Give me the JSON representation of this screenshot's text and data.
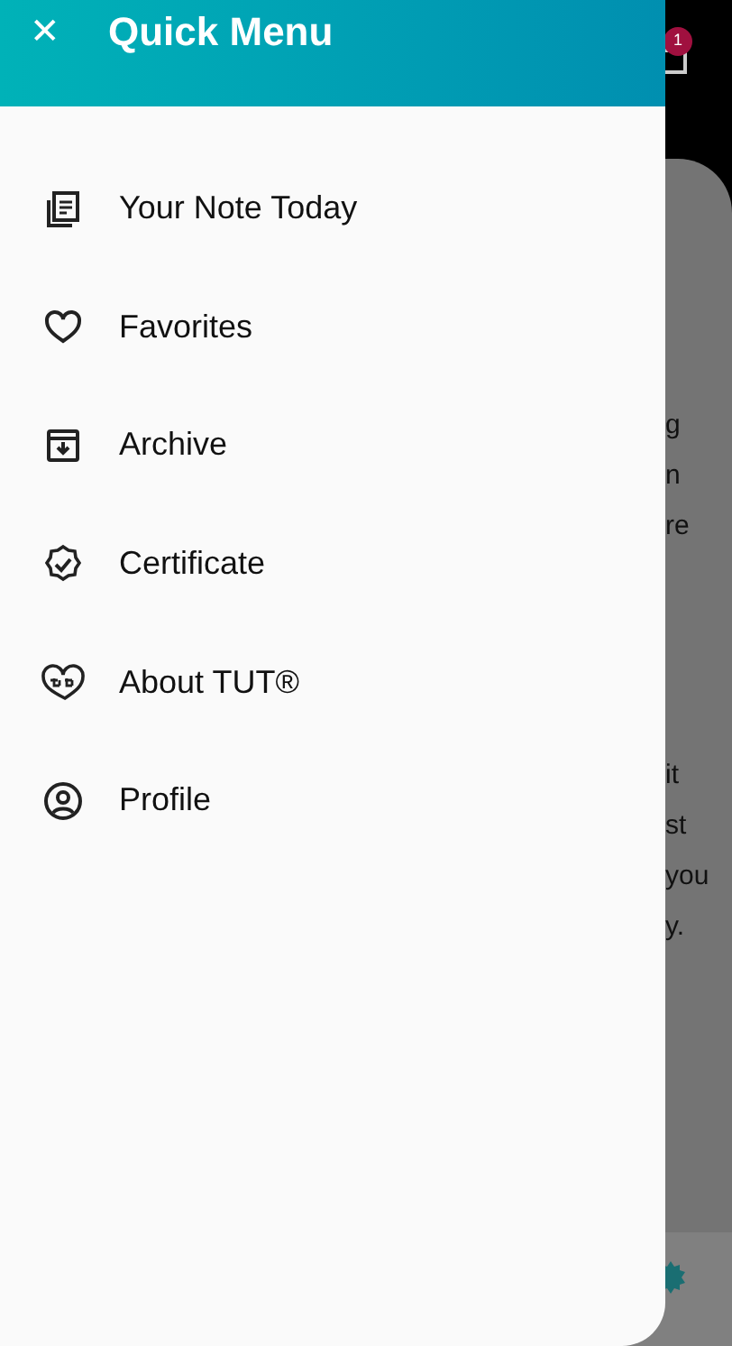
{
  "drawer": {
    "title": "Quick Menu",
    "close_glyph": "✕",
    "items": [
      {
        "label": "Your Note Today",
        "kind": "notes"
      },
      {
        "label": "Favorites",
        "kind": "heart"
      },
      {
        "label": "Archive",
        "kind": "archive"
      },
      {
        "label": "Certificate",
        "kind": "badge"
      },
      {
        "label": "About TUT®",
        "kind": "brand"
      },
      {
        "label": "Profile",
        "kind": "profile"
      }
    ]
  },
  "background": {
    "notification_count": "1",
    "text_fragments": [
      [
        "g",
        "n",
        "re"
      ],
      [
        "it",
        "st",
        "you",
        "y."
      ]
    ]
  }
}
